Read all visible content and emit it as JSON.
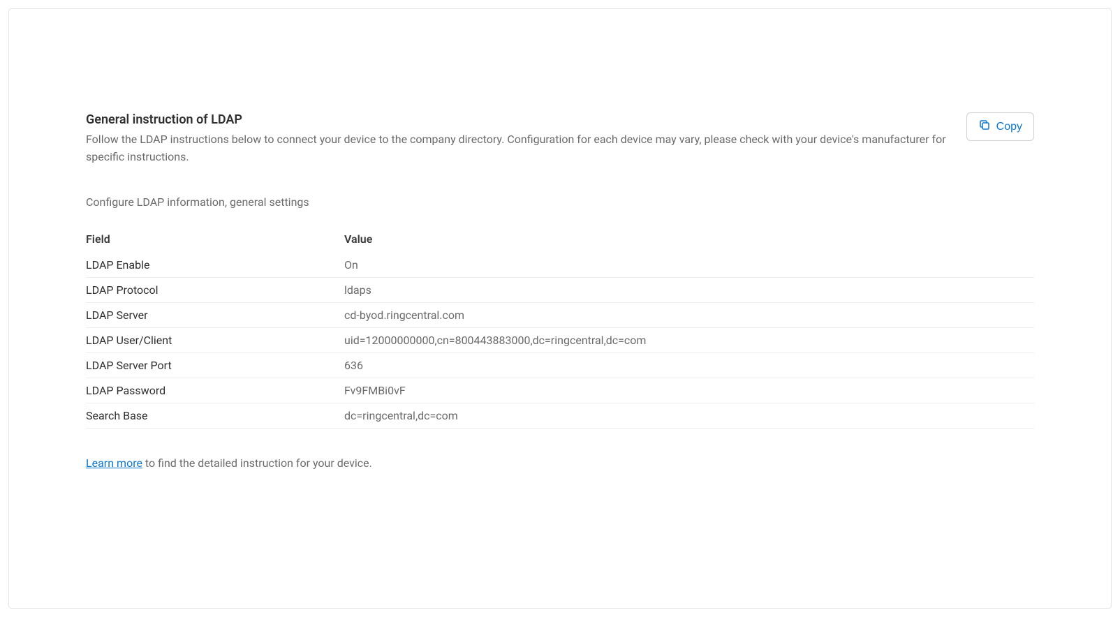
{
  "header": {
    "title": "General instruction of LDAP",
    "subtitle": "Follow the LDAP instructions below to connect your device to the company directory. Configuration for each device may vary, please check with your device's manufacturer for specific instructions.",
    "copy_label": "Copy"
  },
  "section_label": "Configure LDAP information, general settings",
  "table": {
    "header_field": "Field",
    "header_value": "Value",
    "rows": [
      {
        "field": "LDAP Enable",
        "value": "On"
      },
      {
        "field": "LDAP Protocol",
        "value": "ldaps"
      },
      {
        "field": "LDAP Server",
        "value": "cd-byod.ringcentral.com"
      },
      {
        "field": "LDAP User/Client",
        "value": "uid=12000000000,cn=800443883000,dc=ringcentral,dc=com"
      },
      {
        "field": "LDAP Server Port",
        "value": "636"
      },
      {
        "field": "LDAP Password",
        "value": "Fv9FMBi0vF"
      },
      {
        "field": "Search Base",
        "value": "dc=ringcentral,dc=com"
      }
    ]
  },
  "footer": {
    "learn_more": "Learn more",
    "suffix": " to find the detailed instruction for your device."
  }
}
